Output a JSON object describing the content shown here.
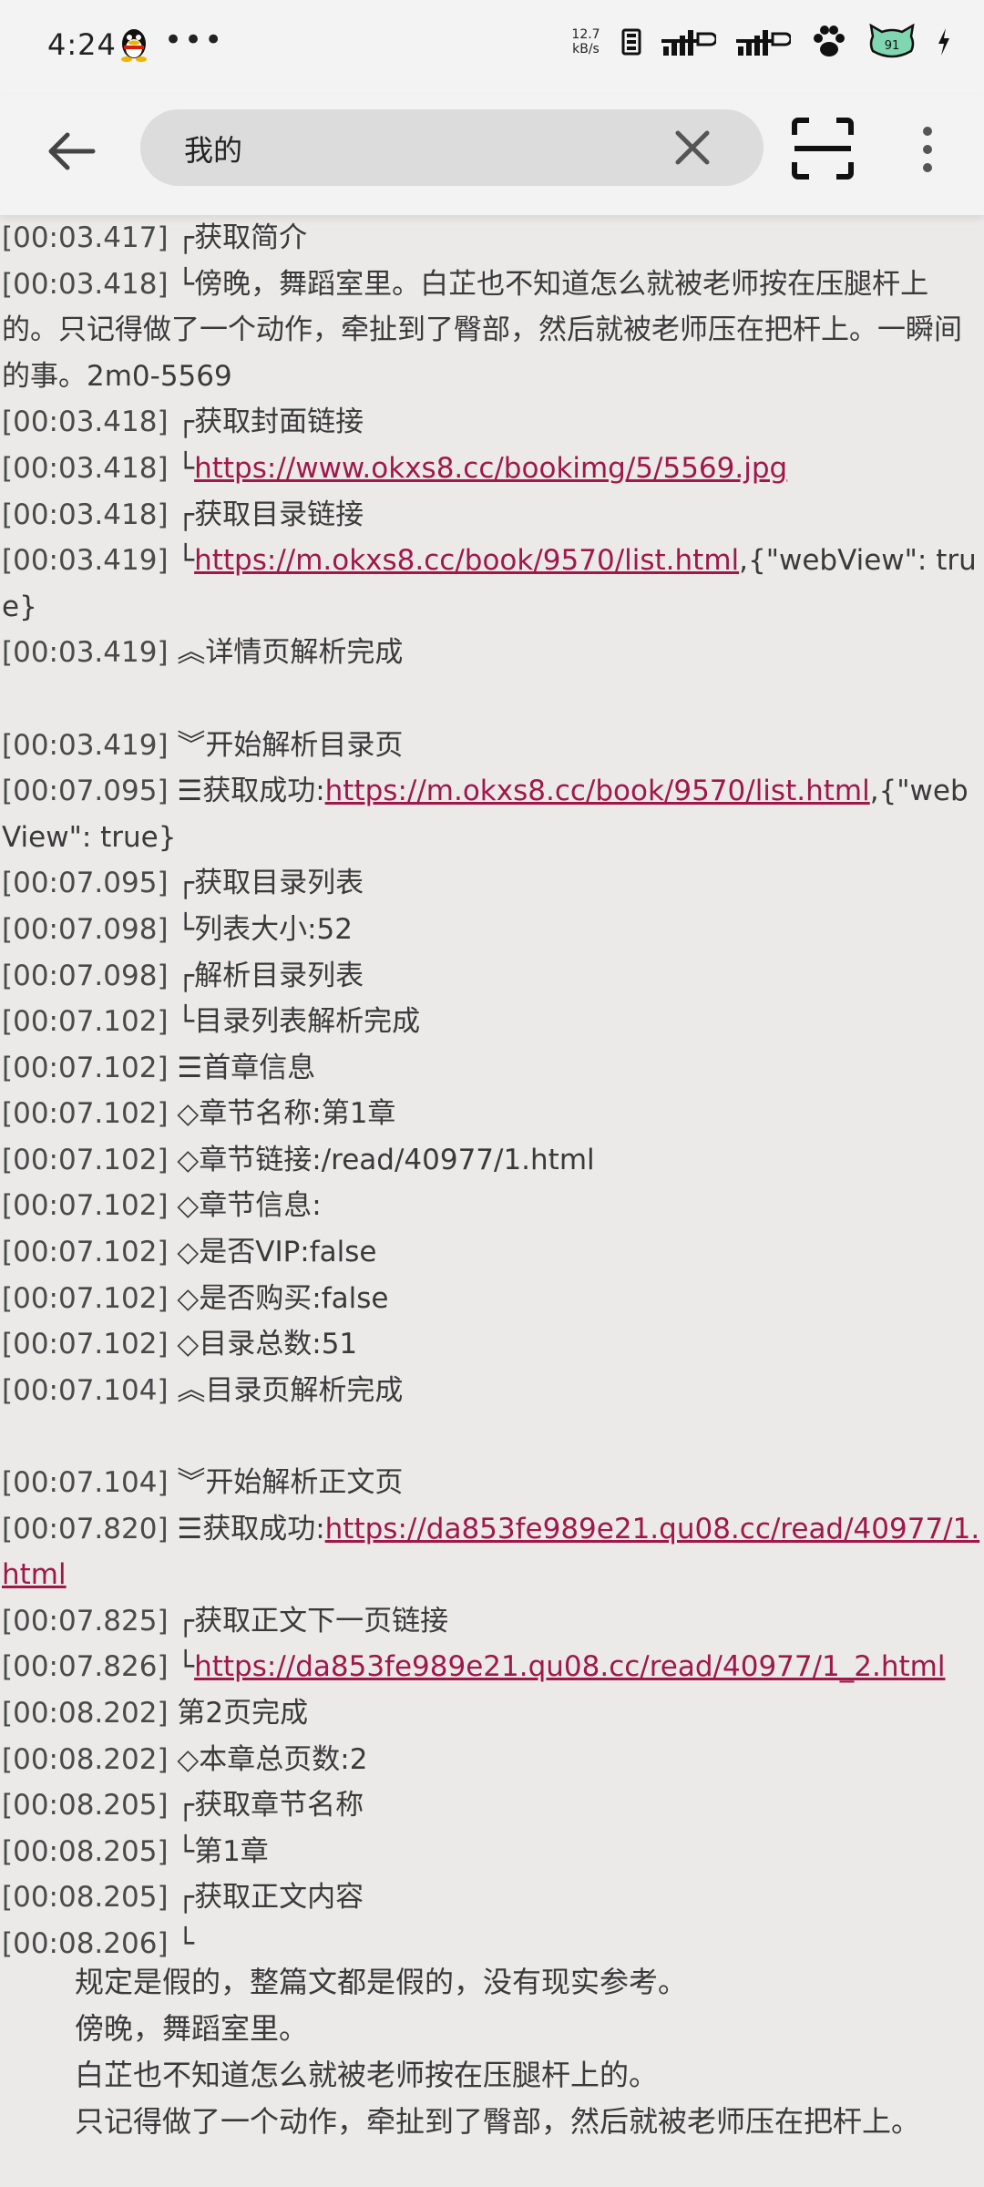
{
  "status_bar": {
    "time": "4:24",
    "dots": "•••",
    "net_speed_value": "12.7",
    "net_speed_unit": "kB/s",
    "battery_level": "91"
  },
  "search": {
    "value": "我的",
    "placeholder": ""
  },
  "log": [
    {
      "ts": "[00:03.417]",
      "text": " ┌获取简介"
    },
    {
      "ts": "[00:03.418]",
      "text": " └傍晚，舞蹈室里。白芷也不知道怎么就被老师按在压腿杆上的。只记得做了一个动作，牵扯到了臀部，然后就被老师压在把杆上。一瞬间的事。2m0-5569"
    },
    {
      "ts": "[00:03.418]",
      "text": " ┌获取封面链接"
    },
    {
      "ts": "[00:03.418]",
      "text": " └",
      "url": "https://www.okxs8.cc/bookimg/5/5569.jpg"
    },
    {
      "ts": "[00:03.418]",
      "text": " ┌获取目录链接"
    },
    {
      "ts": "[00:03.419]",
      "text": " └",
      "url": "https://m.okxs8.cc/book/9570/list.html",
      "after": ",{\"webView\": true}"
    },
    {
      "ts": "[00:03.419]",
      "text": " ︽详情页解析完成"
    },
    {
      "blank": true
    },
    {
      "ts": "[00:03.419]",
      "text": " ︾开始解析目录页"
    },
    {
      "ts": "[00:07.095]",
      "text": " ☰获取成功:",
      "url": "https://m.okxs8.cc/book/9570/list.html",
      "after": ",{\"webView\": true}"
    },
    {
      "ts": "[00:07.095]",
      "text": " ┌获取目录列表"
    },
    {
      "ts": "[00:07.098]",
      "text": " └列表大小:52"
    },
    {
      "ts": "[00:07.098]",
      "text": " ┌解析目录列表"
    },
    {
      "ts": "[00:07.102]",
      "text": " └目录列表解析完成"
    },
    {
      "ts": "[00:07.102]",
      "text": " ☰首章信息"
    },
    {
      "ts": "[00:07.102]",
      "text": " ◇章节名称:第1章"
    },
    {
      "ts": "[00:07.102]",
      "text": " ◇章节链接:/read/40977/1.html"
    },
    {
      "ts": "[00:07.102]",
      "text": " ◇章节信息:"
    },
    {
      "ts": "[00:07.102]",
      "text": " ◇是否VIP:false"
    },
    {
      "ts": "[00:07.102]",
      "text": " ◇是否购买:false"
    },
    {
      "ts": "[00:07.102]",
      "text": " ◇目录总数:51"
    },
    {
      "ts": "[00:07.104]",
      "text": " ︽目录页解析完成"
    },
    {
      "blank": true
    },
    {
      "ts": "[00:07.104]",
      "text": " ︾开始解析正文页"
    },
    {
      "ts": "[00:07.820]",
      "text": " ☰获取成功:",
      "url": "https://da853fe989e21.qu08.cc/read/40977/1.html"
    },
    {
      "ts": "[00:07.825]",
      "text": " ┌获取正文下一页链接"
    },
    {
      "ts": "[00:07.826]",
      "text": " └",
      "url": "https://da853fe989e21.qu08.cc/read/40977/1_2.html"
    },
    {
      "ts": "[00:08.202]",
      "text": " 第2页完成"
    },
    {
      "ts": "[00:08.202]",
      "text": " ◇本章总页数:2"
    },
    {
      "ts": "[00:08.205]",
      "text": " ┌获取章节名称"
    },
    {
      "ts": "[00:08.205]",
      "text": " └第1章"
    },
    {
      "ts": "[00:08.205]",
      "text": " ┌获取正文内容"
    },
    {
      "ts": "[00:08.206]",
      "text": " └"
    }
  ],
  "content": [
    "规定是假的，整篇文都是假的，没有现实参考。",
    "傍晚，舞蹈室里。",
    "白芷也不知道怎么就被老师按在压腿杆上的。",
    "只记得做了一个动作，牵扯到了臀部，然后就被老师压在把杆上。"
  ]
}
